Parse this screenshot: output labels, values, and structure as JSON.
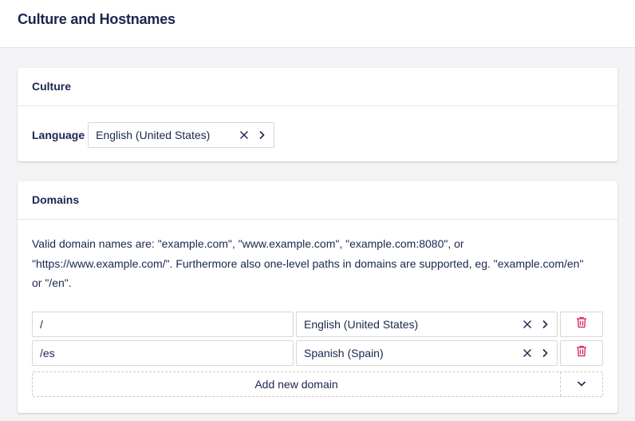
{
  "header": {
    "title": "Culture and Hostnames"
  },
  "culture": {
    "title": "Culture",
    "language_label": "Language",
    "language_value": "English (United States)"
  },
  "domains": {
    "title": "Domains",
    "description": "Valid domain names are: \"example.com\", \"www.example.com\", \"example.com:8080\", or \"https://www.example.com/\". Furthermore also one-level paths in domains are supported, eg. \"example.com/en\" or \"/en\".",
    "rows": [
      {
        "domain": "/",
        "language": "English (United States)"
      },
      {
        "domain": "/es",
        "language": "Spanish (Spain)"
      }
    ],
    "add_label": "Add new domain"
  },
  "colors": {
    "text": "#1b264f",
    "delete_icon": "#d42054",
    "border": "#d8d7d9",
    "page_bg": "#f3f3f5"
  },
  "icons": {
    "clear": "close-icon",
    "open": "chevron-right-icon",
    "delete": "trash-icon",
    "expand": "chevron-down-icon"
  }
}
